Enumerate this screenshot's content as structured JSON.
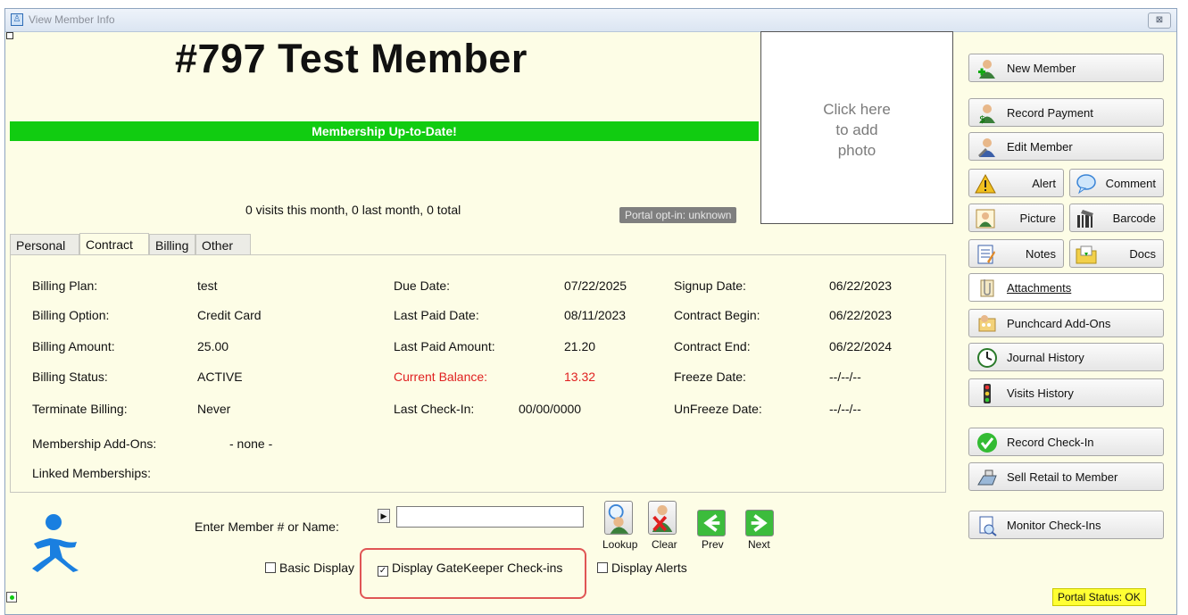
{
  "window": {
    "title": "View Member Info",
    "close_glyph": "⊠"
  },
  "member": {
    "title": "#797  Test Member",
    "status": "Membership Up-to-Date!",
    "visits": "0 visits this month, 0 last month, 0 total",
    "portal_opt": "Portal opt-in: unknown",
    "photo_prompt": [
      "Click here",
      "to add",
      "photo"
    ]
  },
  "tabs": [
    "Personal",
    "Contract",
    "Billing",
    "Other"
  ],
  "contract": {
    "billing_plan_label": "Billing Plan:",
    "billing_plan": "test",
    "billing_option_label": "Billing Option:",
    "billing_option": "Credit Card",
    "billing_amount_label": "Billing Amount:",
    "billing_amount": "25.00",
    "billing_status_label": "Billing Status:",
    "billing_status": "ACTIVE",
    "terminate_label": "Terminate Billing:",
    "terminate": "Never",
    "due_date_label": "Due Date:",
    "due_date": "07/22/2025",
    "last_paid_date_label": "Last Paid Date:",
    "last_paid_date": "08/11/2023",
    "last_paid_amount_label": "Last Paid Amount:",
    "last_paid_amount": "21.20",
    "current_balance_label": "Current Balance:",
    "current_balance": "13.32",
    "last_checkin_label": "Last Check-In:",
    "last_checkin": "00/00/0000",
    "signup_label": "Signup Date:",
    "signup": "06/22/2023",
    "contract_begin_label": "Contract Begin:",
    "contract_begin": "06/22/2023",
    "contract_end_label": "Contract End:",
    "contract_end": "06/22/2024",
    "freeze_label": "Freeze Date:",
    "freeze": "--/--/--",
    "unfreeze_label": "UnFreeze Date:",
    "unfreeze": "--/--/--",
    "addons_label": "Membership Add-Ons:",
    "addons": "- none -",
    "linked_label": "Linked Memberships:"
  },
  "actions": {
    "new_member": "New Member",
    "record_payment": "Record Payment",
    "edit_member": "Edit Member",
    "alert": "Alert",
    "comment": "Comment",
    "picture": "Picture",
    "barcode": "Barcode",
    "notes": "Notes",
    "docs": "Docs",
    "attachments": "Attachments",
    "punchcard": "Punchcard Add-Ons",
    "journal": "Journal History",
    "visits_history": "Visits History",
    "record_checkin": "Record Check-In",
    "sell_retail": "Sell Retail to Member",
    "monitor_checkins": "Monitor Check-Ins"
  },
  "lookup": {
    "label": "Enter Member # or Name:",
    "value": "",
    "lookup": "Lookup",
    "clear": "Clear",
    "prev": "Prev",
    "next": "Next"
  },
  "options": {
    "basic_display": "Basic Display",
    "basic_checked": false,
    "gatekeeper": "Display GateKeeper Check-ins",
    "gatekeeper_checked": true,
    "display_alerts": "Display Alerts",
    "alerts_checked": false
  },
  "footer": {
    "portal_status": "Portal Status: OK"
  },
  "colors": {
    "status_green": "#11cc11",
    "balance_red": "#e02020",
    "panel_bg": "#fdfde6",
    "portal_yellow": "#ffff33"
  }
}
